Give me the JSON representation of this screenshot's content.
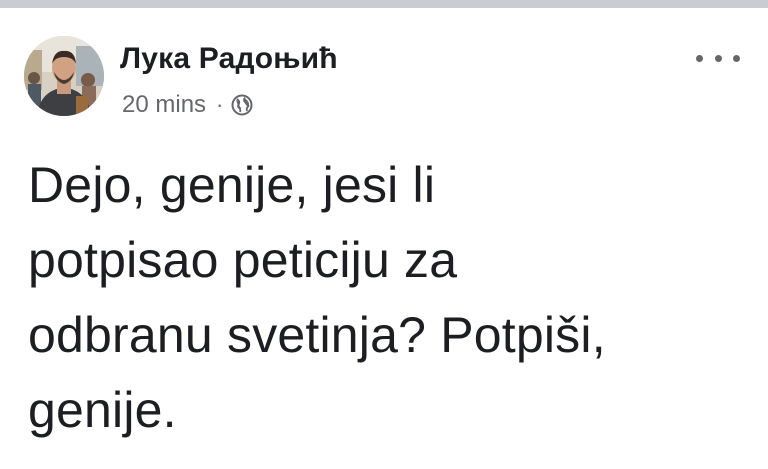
{
  "post": {
    "author_name": "Лука Радоњић",
    "timestamp": "20 mins",
    "separator": "·",
    "privacy_icon": "globe-icon",
    "more_icon": "more-options-icon",
    "text_lines": [
      "Dejo, genije, jesi li",
      "potpisao peticiju za",
      "odbranu svetinja? Potpiši,",
      "genije."
    ]
  },
  "colors": {
    "top_bar": "#c9ccd1",
    "name_text": "#1c1e21",
    "meta_text": "#65676b",
    "background": "#ffffff"
  }
}
